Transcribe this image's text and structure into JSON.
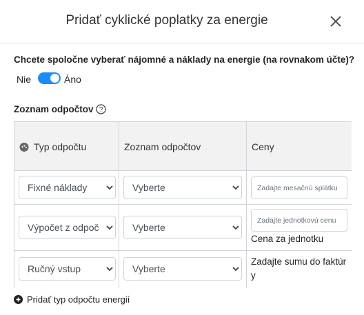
{
  "modal": {
    "title": "Pridať cyklické poplatky za energie"
  },
  "question": "Chcete spoločne vyberať nájomné a náklady na energie (na rovnakom účte)?",
  "toggle": {
    "no_label": "Nie",
    "yes_label": "Áno",
    "value": "Áno",
    "on_color": "#1a8cff"
  },
  "section_title": "Zoznam odpočtov",
  "table": {
    "headers": [
      "Typ odpočtu",
      "Zoznam odpočtov",
      "Ceny"
    ],
    "rows": [
      {
        "type": "Fixné náklady",
        "list": "Vyberte",
        "price_placeholder": "Zadajte mesačnú splátku",
        "price_note": ""
      },
      {
        "type": "Výpočet z odpočtu",
        "list": "Vyberte",
        "price_placeholder": "Zadajte jednotkovú cenu",
        "price_note": "Cena za jednotku"
      },
      {
        "type": "Ručný vstup",
        "list": "Vyberte",
        "price_placeholder": "",
        "price_note": "Zadajte sumu do faktúry"
      }
    ]
  },
  "add_link": "Pridať typ odpočtu energií"
}
